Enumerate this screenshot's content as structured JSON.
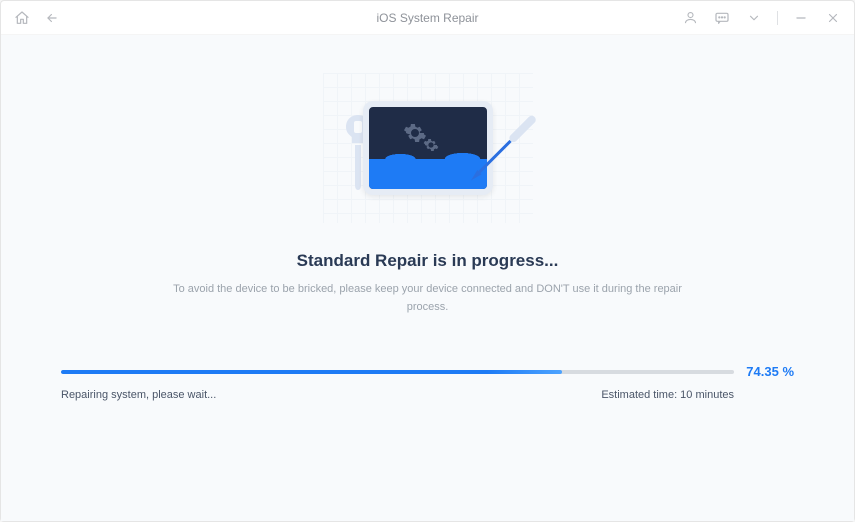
{
  "header": {
    "title": "iOS System Repair"
  },
  "main": {
    "heading": "Standard Repair is in progress...",
    "subtext": "To avoid the device to be bricked, please keep your device connected and DON'T use it during the repair process."
  },
  "progress": {
    "percent_value": 74.35,
    "percent_label": "74.35 %",
    "status": "Repairing system, please wait...",
    "eta": "Estimated time: 10 minutes",
    "fill_width": "74.35%"
  },
  "colors": {
    "accent": "#1e7bf5",
    "dark": "#2a3a55"
  }
}
